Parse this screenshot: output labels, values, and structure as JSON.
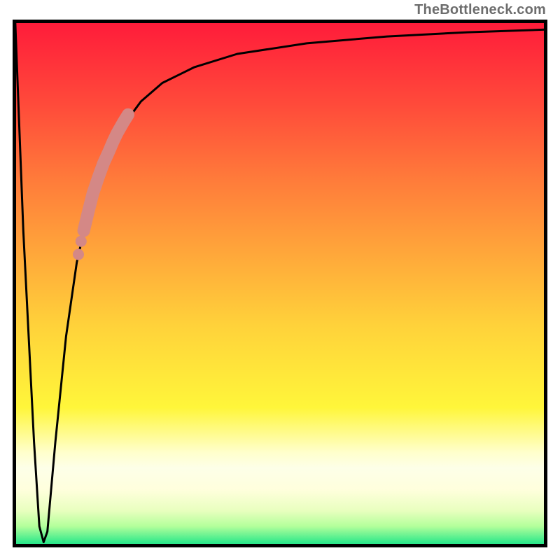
{
  "watermark": "TheBottleneck.com",
  "colors": {
    "top": "#ff1a3a",
    "mid": "#ffd23a",
    "bottom": "#16e38a",
    "curve": "#000000",
    "highlight": "#d48886",
    "border": "#000000"
  },
  "chart_data": {
    "type": "line",
    "title": "",
    "xlabel": "",
    "ylabel": "",
    "xlim": [
      0,
      100
    ],
    "ylim": [
      0,
      100
    ],
    "grid": false,
    "legend": false,
    "note": "No axis ticks or numeric labels are rendered; x and values are expressed as percentages of the plot area.",
    "series": [
      {
        "name": "main-curve",
        "x": [
          0.5,
          2,
          4,
          5,
          5.8,
          6.5,
          8,
          10,
          12,
          14,
          16,
          18,
          20,
          24,
          28,
          34,
          42,
          55,
          70,
          85,
          99.5
        ],
        "values": [
          99.5,
          60,
          20,
          4,
          1,
          3,
          20,
          40,
          54,
          63,
          70,
          75,
          79,
          84.5,
          88,
          91,
          93.5,
          95.5,
          96.8,
          97.6,
          98.1
        ]
      },
      {
        "name": "highlight-segment",
        "x": [
          13.3,
          14,
          15,
          16,
          17,
          18,
          18.8,
          19.5,
          20,
          20.8,
          21.6
        ],
        "values": [
          60,
          63,
          67,
          70,
          72.8,
          75,
          76.9,
          78.4,
          79.3,
          80.7,
          82
        ]
      },
      {
        "name": "highlight-dots",
        "x": [
          12.3,
          12.8
        ],
        "values": [
          55.5,
          58
        ]
      }
    ]
  }
}
